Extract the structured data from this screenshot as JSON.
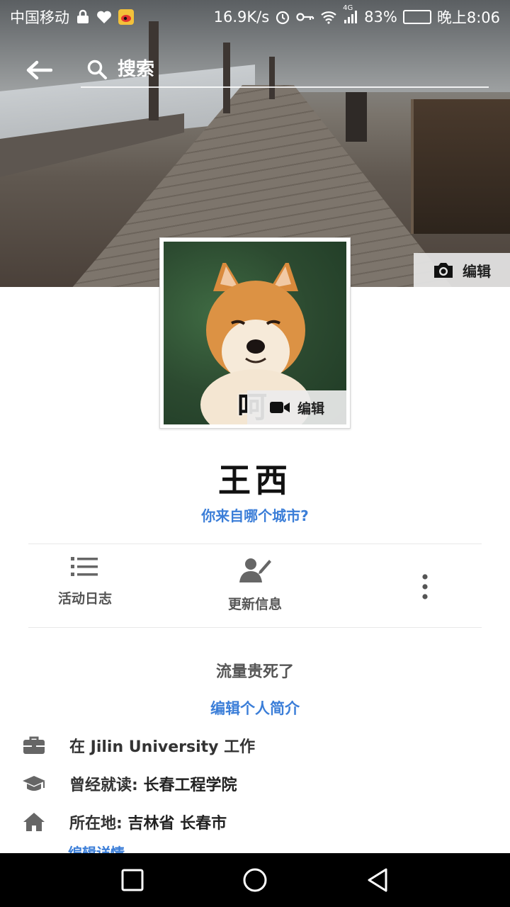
{
  "status_bar": {
    "carrier": "中国移动",
    "net_speed": "16.9K/s",
    "network_type": "4G",
    "battery_percent": "83%",
    "battery_level": 0.83,
    "time": "晚上8:06"
  },
  "top_nav": {
    "search_placeholder": "搜索"
  },
  "cover": {
    "edit_label": "编辑"
  },
  "avatar": {
    "caption": "呵",
    "edit_label": "编辑"
  },
  "profile": {
    "name": "王西",
    "city_prompt": "你来自哪个城市?"
  },
  "actions": {
    "activity_log_label": "活动日志",
    "update_info_label": "更新信息"
  },
  "about": {
    "bio": "流量贵死了",
    "edit_bio_label": "编辑个人简介",
    "work": "在 Jilin University 工作",
    "education_prefix": "曾经就读:",
    "education_school": "长春工程学院",
    "location_prefix": "所在地:",
    "location_value": "吉林省 长春市",
    "next_item_partial": "编辑详情"
  },
  "colors": {
    "link_blue": "#3b7ed8",
    "battery_green": "#3ecf4a",
    "navbar_black": "#000000"
  }
}
